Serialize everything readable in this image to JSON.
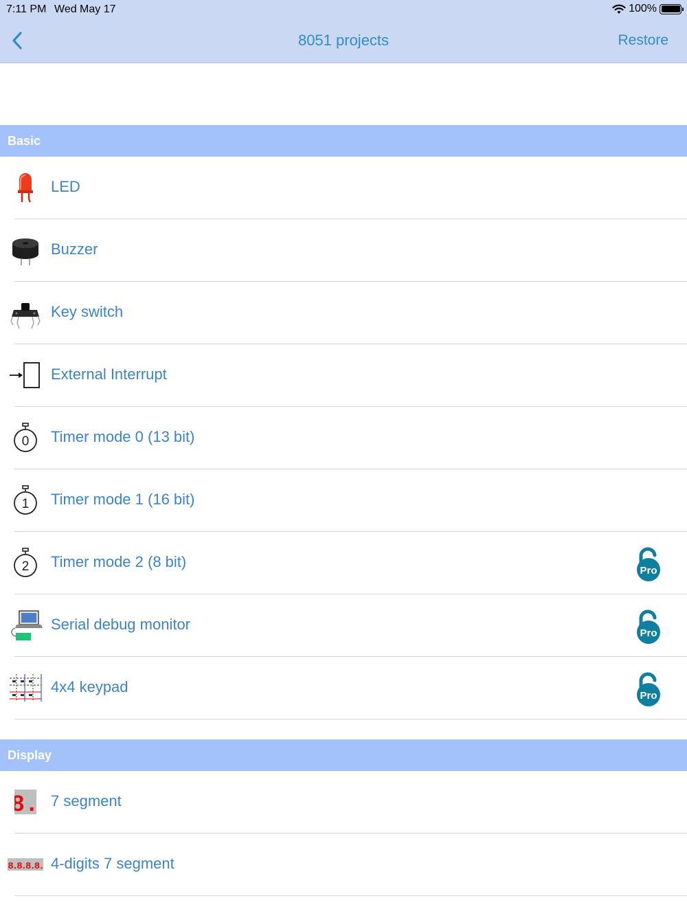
{
  "status": {
    "time": "7:11 PM",
    "date": "Wed May 17",
    "battery": "100%"
  },
  "nav": {
    "title": "8051 projects",
    "restore": "Restore"
  },
  "sections": [
    {
      "title": "Basic",
      "items": [
        {
          "label": "LED",
          "icon": "led-icon"
        },
        {
          "label": "Buzzer",
          "icon": "buzzer-icon"
        },
        {
          "label": "Key switch",
          "icon": "key-switch-icon"
        },
        {
          "label": "External Interrupt",
          "icon": "external-interrupt-icon"
        },
        {
          "label": "Timer mode 0 (13 bit)",
          "icon": "timer-0-icon",
          "glyph": "0"
        },
        {
          "label": "Timer mode 1 (16 bit)",
          "icon": "timer-1-icon",
          "glyph": "1"
        },
        {
          "label": "Timer mode 2 (8 bit)",
          "icon": "timer-2-icon",
          "glyph": "2",
          "locked": "Pro"
        },
        {
          "label": "Serial debug monitor",
          "icon": "serial-monitor-icon",
          "locked": "Pro"
        },
        {
          "label": "4x4 keypad",
          "icon": "keypad-icon",
          "locked": "Pro"
        }
      ]
    },
    {
      "title": "Display",
      "items": [
        {
          "label": "7 segment",
          "icon": "seven-segment-icon",
          "glyph": "8."
        },
        {
          "label": "4-digits 7 segment",
          "icon": "four-digit-segment-icon",
          "glyph": "8.8.8.8."
        }
      ]
    }
  ],
  "colors": {
    "nav_bg": "#cad8f4",
    "accent": "#2f8fc0",
    "section_bg": "#a3c1fb",
    "label": "#3d84c7",
    "pro_badge": "#0f7fa0"
  }
}
